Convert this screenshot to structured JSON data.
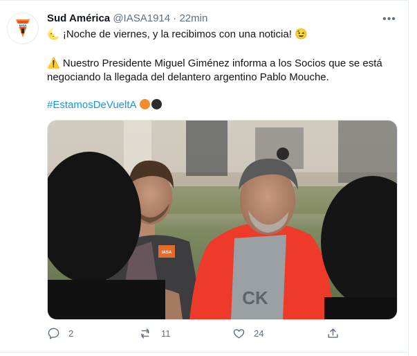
{
  "tweet": {
    "author_name": "Sud América",
    "handle": "@IASA1914",
    "separator": " · ",
    "time": "22min",
    "more_label": "•••",
    "line1": "¡Noche de viernes, y la recibimos con una noticia!",
    "line1_prefix_emoji": "🌜",
    "line1_suffix_emoji": "😉",
    "line2_emoji": "⚠️",
    "line2": "Nuestro Presidente Miguel Giménez informa a los Socios que se está negociando la llegada del delantero argentino Pablo Mouche.",
    "hashtag": "#EstamosDeVueltA",
    "hashtag_dots": [
      "#f28a2e",
      "#2b2b2b"
    ],
    "photo": {
      "jersey_badge_text": "IASA",
      "jacket_brand": "CK"
    },
    "actions": {
      "reply_count": "2",
      "retweet_count": "11",
      "like_count": "24",
      "share_label": ""
    }
  },
  "colors": {
    "accent": "#1b95e0",
    "muted": "#5b7083",
    "jacket": "#ee3a28",
    "brand_orange": "#f28a2e"
  }
}
